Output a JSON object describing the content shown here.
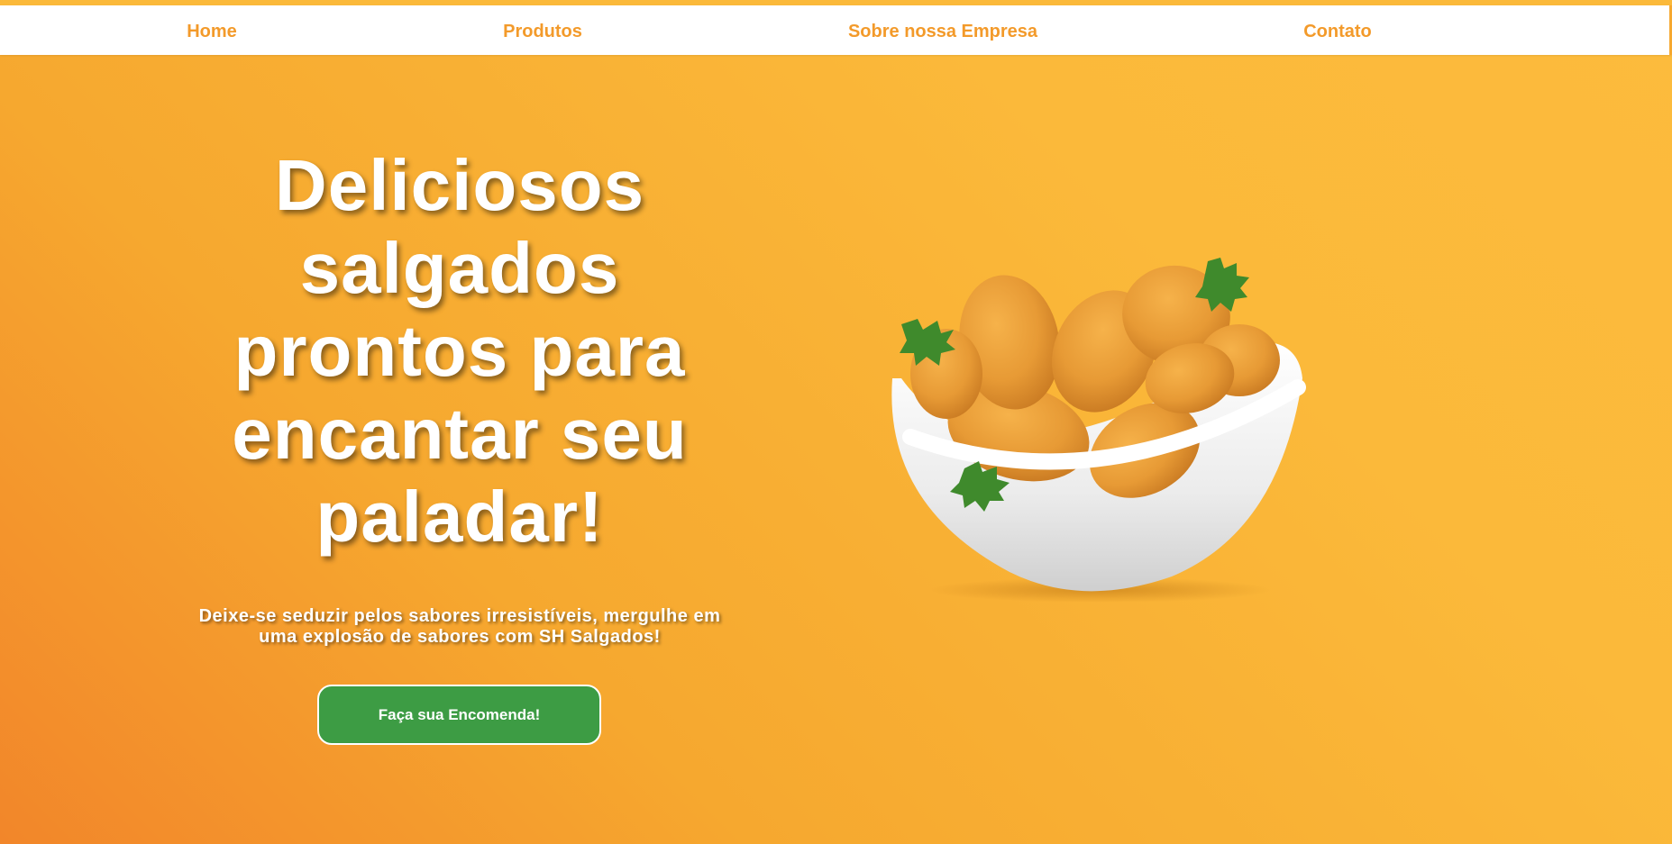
{
  "nav": {
    "links": [
      {
        "label": "Home"
      },
      {
        "label": "Produtos"
      },
      {
        "label": "Sobre nossa Empresa"
      },
      {
        "label": "Contato"
      }
    ]
  },
  "hero": {
    "title": "Deliciosos salgados prontos para encantar seu paladar!",
    "subtitle": "Deixe-se seduzir pelos sabores irresistíveis, mergulhe em uma explosão de sabores com SH Salgados!",
    "cta_label": "Faça sua Encomenda!"
  },
  "colors": {
    "nav_link": "#f39a2a",
    "cta_background": "#3d9c44",
    "background_start": "#f2862a",
    "background_end": "#fcbb3d"
  }
}
